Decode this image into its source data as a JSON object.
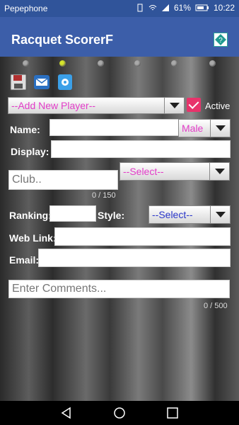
{
  "status": {
    "carrier": "Pepephone",
    "battery": "61%",
    "time": "10:22"
  },
  "app": {
    "title": "Racquet ScorerF",
    "help": "?"
  },
  "player": {
    "select": "--Add New Player--",
    "active_label": "Active",
    "name_label": "Name:",
    "gender": "Male",
    "display_label": "Display:",
    "club_placeholder": "Club..",
    "club_select": "--Select--",
    "club_count": "0 / 150",
    "ranking_label": "Ranking:",
    "style_label": "Style:",
    "style_select": "--Select--",
    "weblink_label": "Web Link:",
    "email_label": "Email:",
    "comments_placeholder": "Enter Comments...",
    "comments_count": "0 / 500"
  }
}
